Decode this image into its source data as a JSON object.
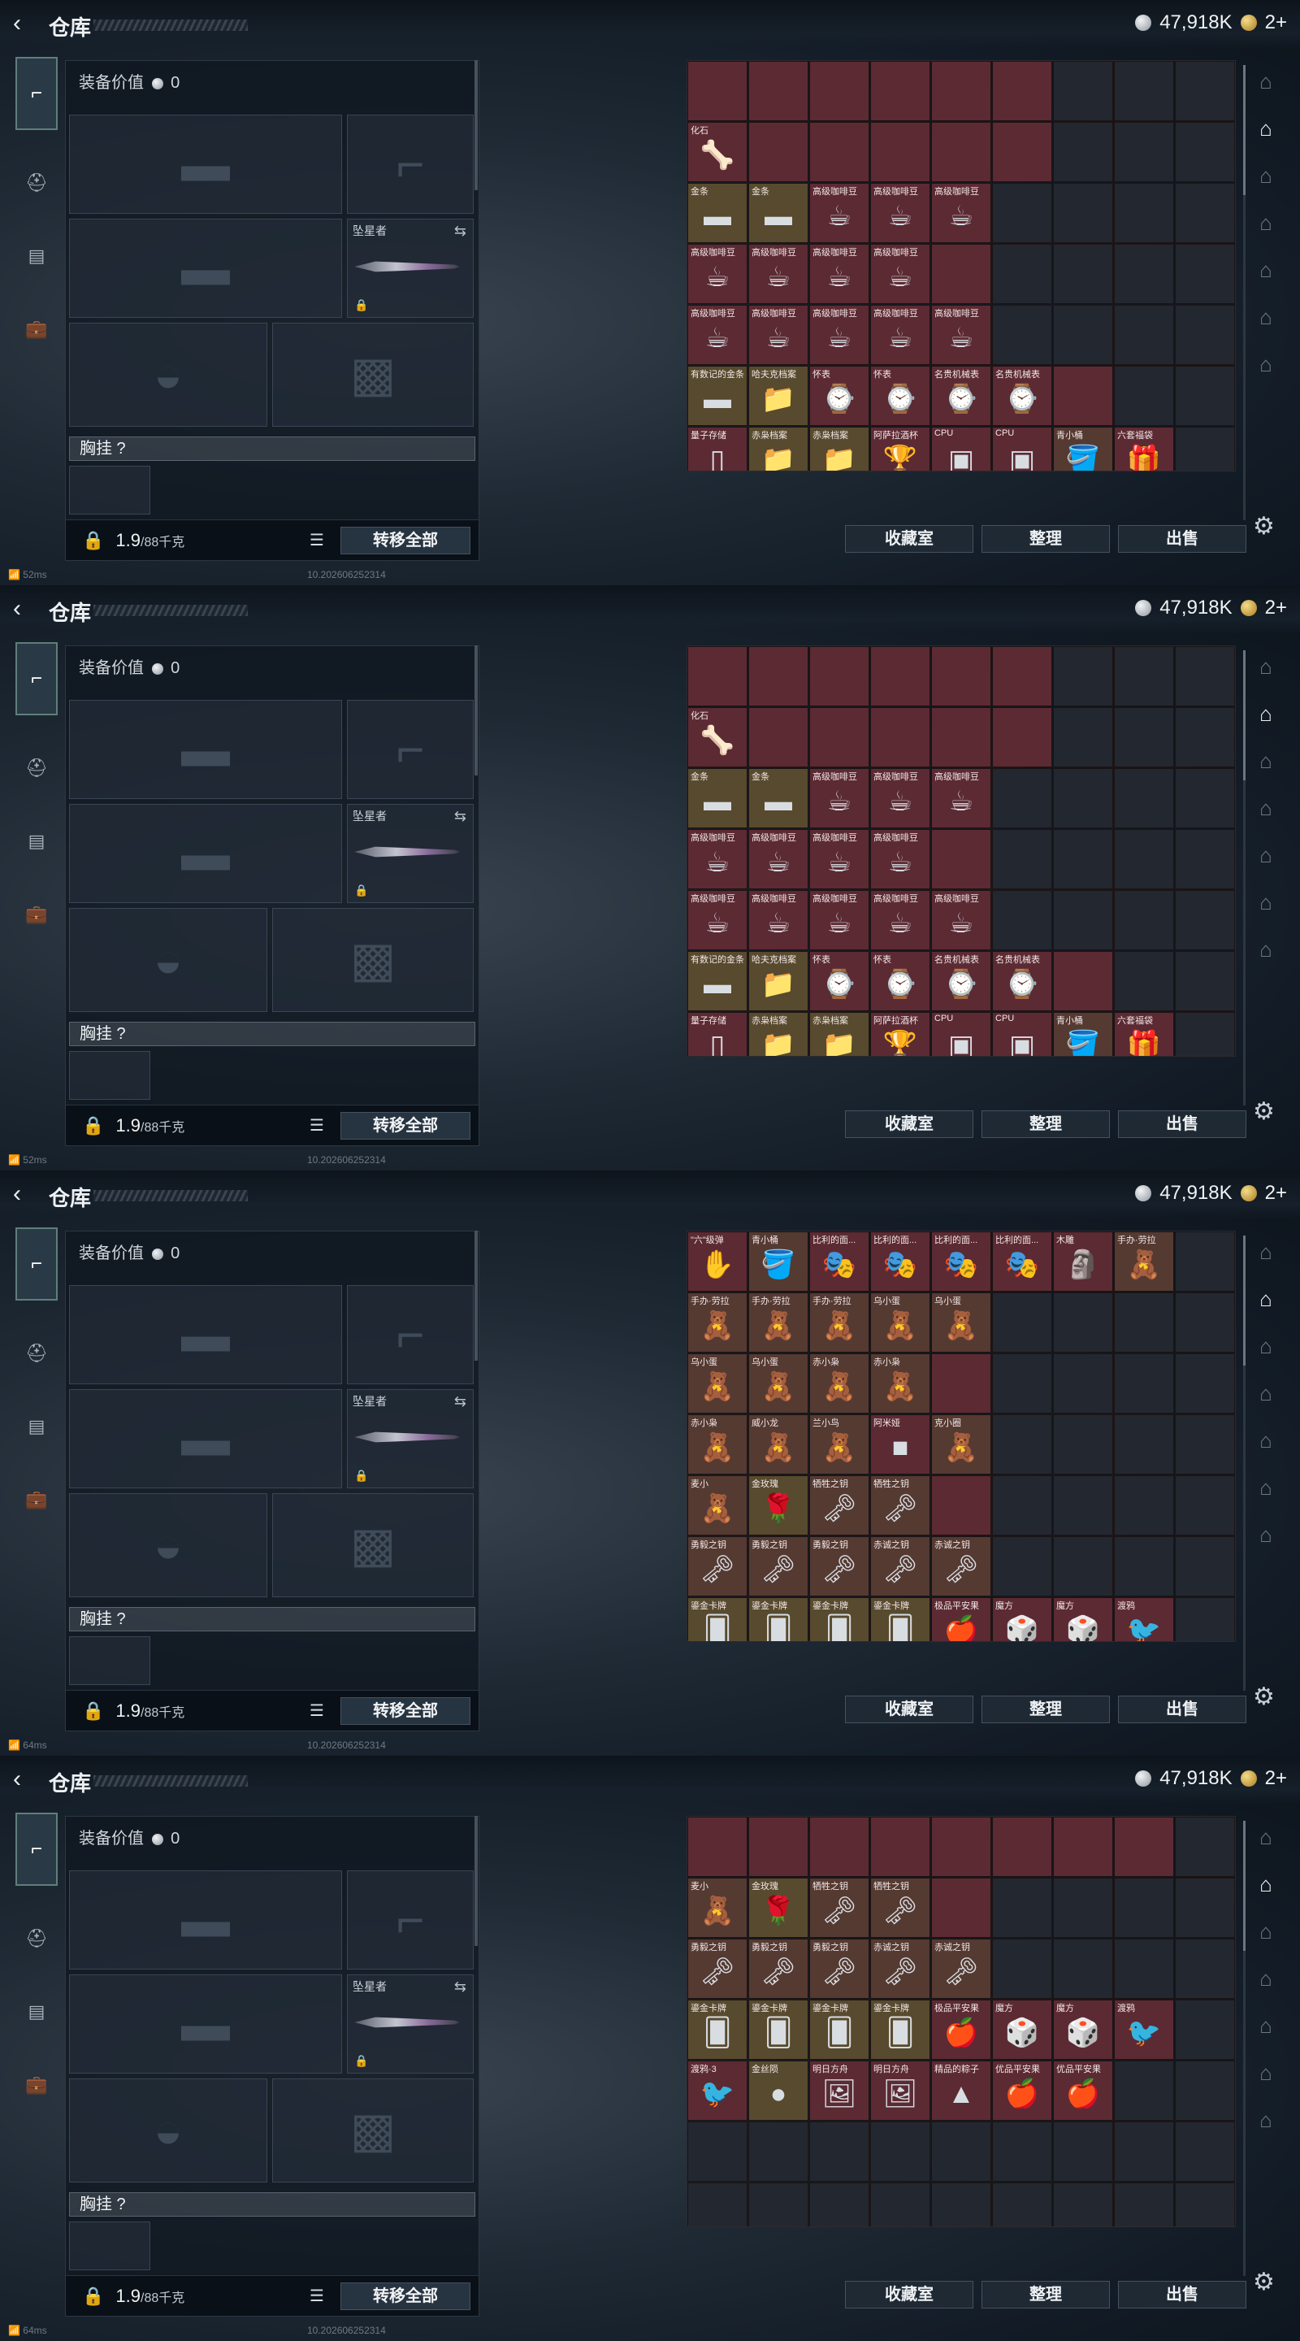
{
  "frames": [
    {
      "title": "仓库",
      "equip_value_label": "装备价值",
      "equip_value": "0",
      "money": "47,918K",
      "gold": "2+",
      "slot_melee_label": "坠星者",
      "chest_label": "胸挂 ?",
      "weight": "1.9",
      "weight_max": "/88千克",
      "transfer_all": "转移全部",
      "btn_collection": "收藏室",
      "btn_organize": "整理",
      "btn_sell": "出售",
      "ping": "52ms",
      "build": "10.202606252314"
    },
    {
      "title": "仓库",
      "equip_value_label": "装备价值",
      "equip_value": "0",
      "money": "47,918K",
      "gold": "2+",
      "slot_melee_label": "坠星者",
      "chest_label": "胸挂 ?",
      "weight": "1.9",
      "weight_max": "/88千克",
      "transfer_all": "转移全部",
      "btn_collection": "收藏室",
      "btn_organize": "整理",
      "btn_sell": "出售",
      "ping": "52ms",
      "build": "10.202606252314"
    },
    {
      "title": "仓库",
      "equip_value_label": "装备价值",
      "equip_value": "0",
      "money": "47,918K",
      "gold": "2+",
      "slot_melee_label": "坠星者",
      "chest_label": "胸挂 ?",
      "weight": "1.9",
      "weight_max": "/88千克",
      "transfer_all": "转移全部",
      "btn_collection": "收藏室",
      "btn_organize": "整理",
      "btn_sell": "出售",
      "ping": "64ms",
      "build": "10.202606252314"
    },
    {
      "title": "仓库",
      "equip_value_label": "装备价值",
      "equip_value": "0",
      "money": "47,918K",
      "gold": "2+",
      "slot_melee_label": "坠星者",
      "chest_label": "胸挂 ?",
      "weight": "1.9",
      "weight_max": "/88千克",
      "transfer_all": "转移全部",
      "btn_collection": "收藏室",
      "btn_organize": "整理",
      "btn_sell": "出售",
      "ping": "64ms",
      "build": "10.202606252314"
    }
  ],
  "grids": [
    [
      [
        "",
        "",
        "",
        "",
        "",
        ""
      ],
      [
        "化石",
        "",
        "",
        "",
        "",
        ""
      ],
      [
        "金条",
        "金条",
        "高级咖啡豆",
        "高级咖啡豆",
        "高级咖啡豆"
      ],
      [
        "高级咖啡豆",
        "高级咖啡豆",
        "高级咖啡豆",
        "高级咖啡豆",
        ""
      ],
      [
        "高级咖啡豆",
        "高级咖啡豆",
        "高级咖啡豆",
        "高级咖啡豆",
        "高级咖啡豆"
      ],
      [
        "有数记的金条",
        "哈夫克档案",
        "怀表",
        "怀表",
        "名贵机械表",
        "名贵机械表",
        ""
      ],
      [
        "量子存储",
        "赤枭档案",
        "赤枭档案",
        "阿萨拉酒杯",
        "CPU",
        "CPU",
        "青小桶",
        "六套福袋"
      ]
    ],
    [
      [
        "",
        "",
        "",
        "",
        "",
        ""
      ],
      [
        "化石",
        "",
        "",
        "",
        "",
        ""
      ],
      [
        "金条",
        "金条",
        "高级咖啡豆",
        "高级咖啡豆",
        "高级咖啡豆"
      ],
      [
        "高级咖啡豆",
        "高级咖啡豆",
        "高级咖啡豆",
        "高级咖啡豆",
        ""
      ],
      [
        "高级咖啡豆",
        "高级咖啡豆",
        "高级咖啡豆",
        "高级咖啡豆",
        "高级咖啡豆"
      ],
      [
        "有数记的金条",
        "哈夫克档案",
        "怀表",
        "怀表",
        "名贵机械表",
        "名贵机械表",
        ""
      ],
      [
        "量子存储",
        "赤枭档案",
        "赤枭档案",
        "阿萨拉酒杯",
        "CPU",
        "CPU",
        "青小桶",
        "六套福袋"
      ]
    ],
    [
      [
        "\"六\"级弹",
        "青小桶",
        "比利的面...",
        "比利的面...",
        "比利的面...",
        "比利的面...",
        "木雕",
        "手办·劳拉"
      ],
      [
        "手办·劳拉",
        "手办·劳拉",
        "手办·劳拉",
        "乌小蛋",
        "乌小蛋"
      ],
      [
        "乌小蛋",
        "乌小蛋",
        "赤小枭",
        "赤小枭",
        ""
      ],
      [
        "赤小枭",
        "威小龙",
        "兰小鸟",
        "阿米娅",
        "克小圈"
      ],
      [
        "麦小",
        "金玫瑰",
        "牺牲之钥",
        "牺牲之钥",
        ""
      ],
      [
        "勇毅之钥",
        "勇毅之钥",
        "勇毅之钥",
        "赤诚之钥",
        "赤诚之钥"
      ],
      [
        "鎏金卡牌",
        "鎏金卡牌",
        "鎏金卡牌",
        "鎏金卡牌",
        "极品平安果",
        "魔方",
        "魔方",
        "渡鸦"
      ]
    ],
    [
      [
        "",
        "",
        "",
        "",
        "",
        "",
        "",
        ""
      ],
      [
        "麦小",
        "金玫瑰",
        "牺牲之钥",
        "牺牲之钥",
        ""
      ],
      [
        "勇毅之钥",
        "勇毅之钥",
        "勇毅之钥",
        "赤诚之钥",
        "赤诚之钥"
      ],
      [
        "鎏金卡牌",
        "鎏金卡牌",
        "鎏金卡牌",
        "鎏金卡牌",
        "极品平安果",
        "魔方",
        "魔方",
        "渡鸦"
      ],
      [
        "渡鸦·3",
        "金丝陨",
        "明日方舟",
        "明日方舟",
        "精品的粽子",
        "优品平安果",
        "优品平安果"
      ],
      [],
      []
    ]
  ],
  "icons": {
    "back": "‹",
    "list": "☰",
    "lock": "🔒",
    "swap": "⇆",
    "gear": "⚙"
  }
}
